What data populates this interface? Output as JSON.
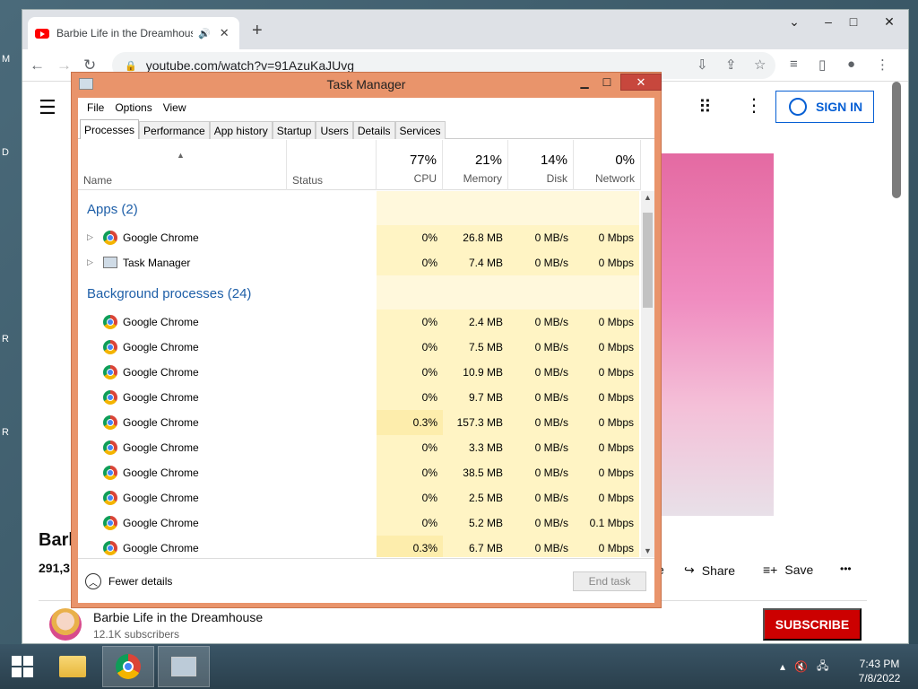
{
  "desktop": {
    "side_letters": [
      "M",
      "D",
      "R",
      "R"
    ]
  },
  "browser": {
    "tab_title": "Barbie Life in the Dreamhouse",
    "tab_audio_icon": "speaker-icon",
    "new_tab": "+",
    "url": "youtube.com/watch?v=91AzuKaJUvg",
    "window_controls": {
      "minimize": "–",
      "maximize": "□",
      "close": "✕"
    }
  },
  "youtube": {
    "signin_label": "SIGN IN",
    "video_title": "Barb",
    "views": "291,3",
    "share_label": "Share",
    "save_label": "Save",
    "channel_name": "Barbie Life in the Dreamhouse",
    "subscribers": "12.1K subscribers",
    "subscribe_label": "SUBSCRIBE",
    "partial_like": "e",
    "more": "•••"
  },
  "task_manager": {
    "title": "Task Manager",
    "menu": [
      "File",
      "Options",
      "View"
    ],
    "tabs": [
      "Processes",
      "Performance",
      "App history",
      "Startup",
      "Users",
      "Details",
      "Services"
    ],
    "active_tab": "Processes",
    "columns": {
      "name": "Name",
      "status": "Status",
      "cpu": {
        "pct": "77%",
        "label": "CPU"
      },
      "memory": {
        "pct": "21%",
        "label": "Memory"
      },
      "disk": {
        "pct": "14%",
        "label": "Disk"
      },
      "network": {
        "pct": "0%",
        "label": "Network"
      }
    },
    "groups": {
      "apps": "Apps (2)",
      "background": "Background processes (24)"
    },
    "apps": [
      {
        "name": "Google Chrome",
        "cpu": "0%",
        "memory": "26.8 MB",
        "disk": "0 MB/s",
        "network": "0 Mbps",
        "icon": "chrome-icon"
      },
      {
        "name": "Task Manager",
        "cpu": "0%",
        "memory": "7.4 MB",
        "disk": "0 MB/s",
        "network": "0 Mbps",
        "icon": "task-manager-icon"
      }
    ],
    "background": [
      {
        "name": "Google Chrome",
        "cpu": "0%",
        "memory": "2.4 MB",
        "disk": "0 MB/s",
        "network": "0 Mbps"
      },
      {
        "name": "Google Chrome",
        "cpu": "0%",
        "memory": "7.5 MB",
        "disk": "0 MB/s",
        "network": "0 Mbps"
      },
      {
        "name": "Google Chrome",
        "cpu": "0%",
        "memory": "10.9 MB",
        "disk": "0 MB/s",
        "network": "0 Mbps"
      },
      {
        "name": "Google Chrome",
        "cpu": "0%",
        "memory": "9.7 MB",
        "disk": "0 MB/s",
        "network": "0 Mbps"
      },
      {
        "name": "Google Chrome",
        "cpu": "0.3%",
        "memory": "157.3 MB",
        "disk": "0 MB/s",
        "network": "0 Mbps"
      },
      {
        "name": "Google Chrome",
        "cpu": "0%",
        "memory": "3.3 MB",
        "disk": "0 MB/s",
        "network": "0 Mbps"
      },
      {
        "name": "Google Chrome",
        "cpu": "0%",
        "memory": "38.5 MB",
        "disk": "0 MB/s",
        "network": "0 Mbps"
      },
      {
        "name": "Google Chrome",
        "cpu": "0%",
        "memory": "2.5 MB",
        "disk": "0 MB/s",
        "network": "0 Mbps"
      },
      {
        "name": "Google Chrome",
        "cpu": "0%",
        "memory": "5.2 MB",
        "disk": "0 MB/s",
        "network": "0.1 Mbps"
      },
      {
        "name": "Google Chrome",
        "cpu": "0.3%",
        "memory": "6.7 MB",
        "disk": "0 MB/s",
        "network": "0 Mbps"
      }
    ],
    "fewer_details": "Fewer details",
    "end_task": "End task"
  },
  "taskbar": {
    "time": "7:43 PM",
    "date": "7/8/2022",
    "items": [
      "file-explorer",
      "google-chrome",
      "task-manager"
    ]
  }
}
